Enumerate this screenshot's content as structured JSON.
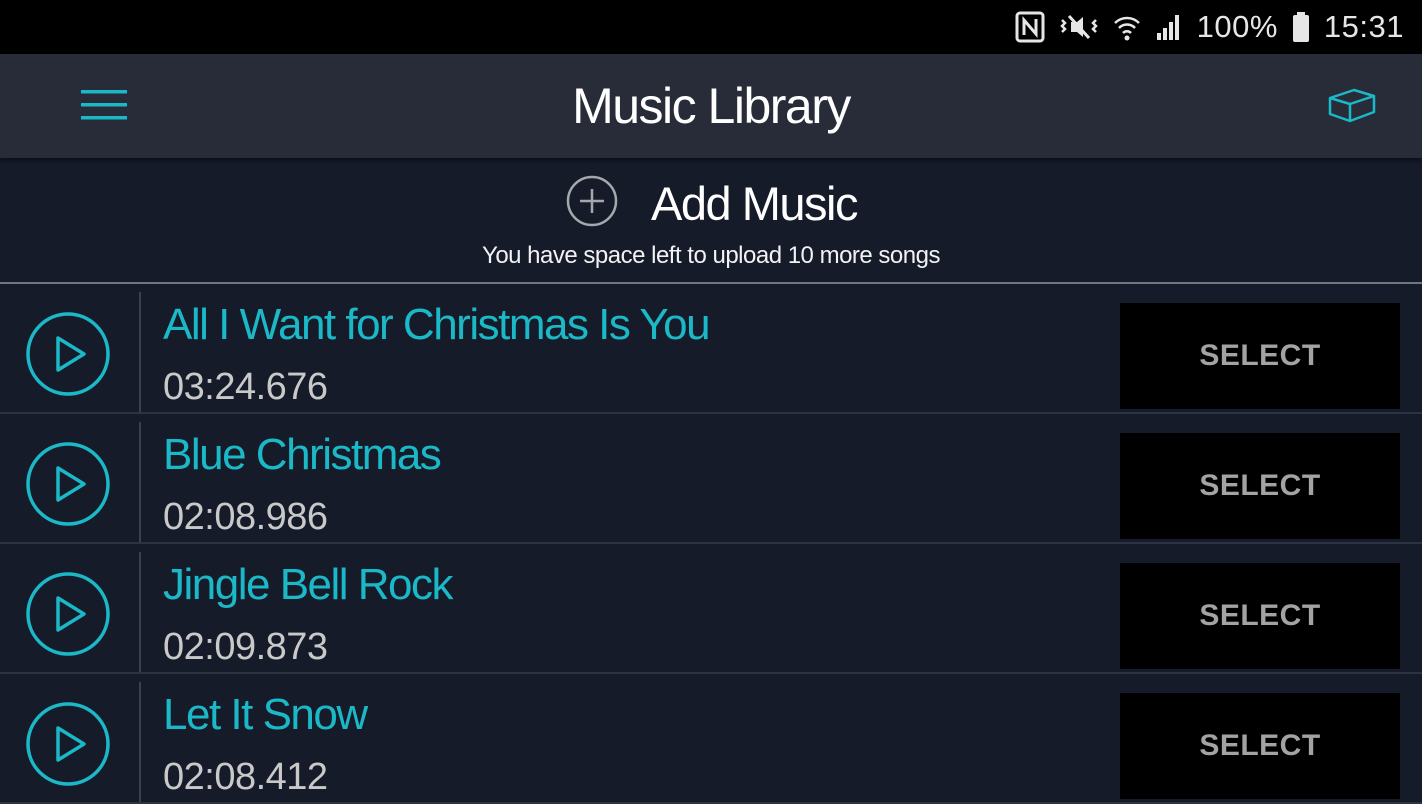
{
  "status_bar": {
    "battery": "100%",
    "time": "15:31",
    "icons": [
      "nfc-icon",
      "vibrate-icon",
      "wifi-icon",
      "signal-icon",
      "battery-icon"
    ]
  },
  "app_bar": {
    "title": "Music Library",
    "menu_icon": "hamburger-menu-icon",
    "action_icon": "cube-box-icon"
  },
  "add_music": {
    "label": "Add Music",
    "icon": "plus-circle-icon",
    "note": "You have space left to upload 10 more songs"
  },
  "songs": [
    {
      "title": "All I Want for Christmas Is You",
      "duration": "03:24.676",
      "action": "SELECT"
    },
    {
      "title": "Blue Christmas",
      "duration": "02:08.986",
      "action": "SELECT"
    },
    {
      "title": "Jingle Bell Rock",
      "duration": "02:09.873",
      "action": "SELECT"
    },
    {
      "title": "Let It Snow",
      "duration": "02:08.412",
      "action": "SELECT"
    }
  ],
  "colors": {
    "accent": "#1bb8c8",
    "background": "#161b29",
    "app_bar": "#272c38",
    "select_button": "#000000",
    "select_text": "#a3a3a3"
  }
}
